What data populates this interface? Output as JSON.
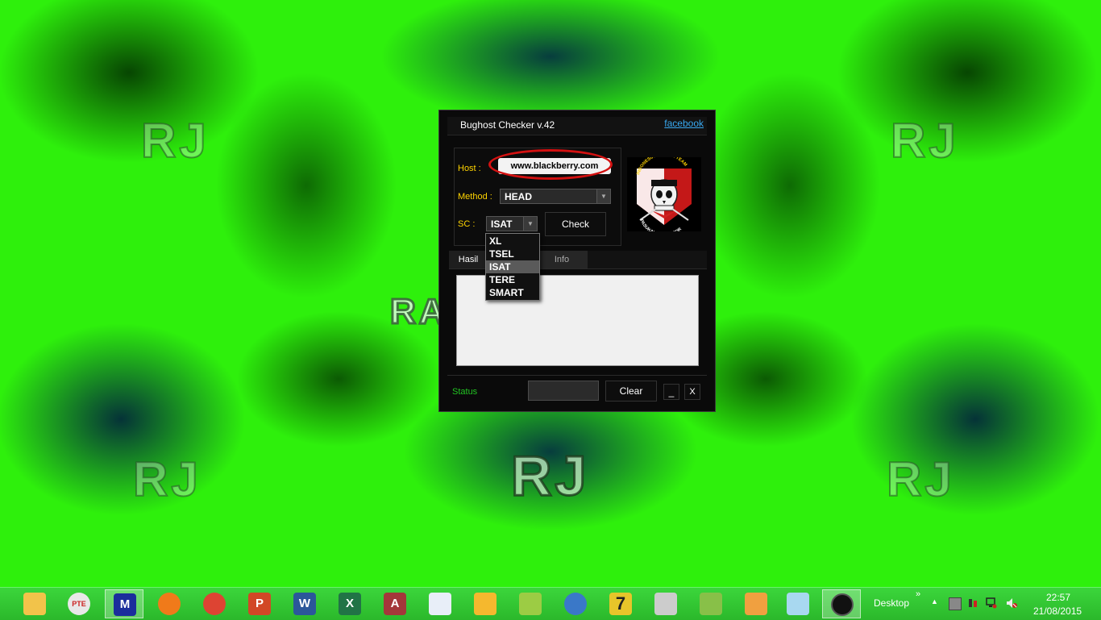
{
  "wallpaper": {
    "watermarks": [
      "RJ",
      "RJ",
      "RJ",
      "RJ",
      "RJ",
      "RA"
    ]
  },
  "app": {
    "title": "Bughost Checker v.42",
    "facebook_link": "facebook",
    "host_label": "Host :",
    "host_value": "www.blackberry.com",
    "method_label": "Method :",
    "method_value": "HEAD",
    "sc_label": "SC :",
    "sc_value": "ISAT",
    "sc_options": [
      "XL",
      "TSEL",
      "ISAT",
      "TERE",
      "SMART"
    ],
    "check_button": "Check",
    "tabs": [
      "Hasil",
      "Info"
    ],
    "status_label": "Status",
    "progress": 0,
    "clear_button": "Clear",
    "minimize_button": "_",
    "close_button": "X",
    "logo_text_top": "INDONESIAN CYBER TEAM",
    "logo_text_bottom": "PASUKAN ANTI TEROR"
  },
  "taskbar": {
    "apps": [
      {
        "name": "file-explorer",
        "text": "",
        "color": "#f2c34a"
      },
      {
        "name": "pte-patch",
        "text": "PTE",
        "color": "#e8e8e8"
      },
      {
        "name": "m-app",
        "text": "M",
        "color": "#1b2e9c"
      },
      {
        "name": "firefox",
        "text": "",
        "color": "#f07a1a"
      },
      {
        "name": "chrome",
        "text": "",
        "color": "#dd4433"
      },
      {
        "name": "powerpoint",
        "text": "P",
        "color": "#d24726"
      },
      {
        "name": "word",
        "text": "W",
        "color": "#2b579a"
      },
      {
        "name": "excel",
        "text": "X",
        "color": "#217346"
      },
      {
        "name": "access",
        "text": "A",
        "color": "#a4373a"
      },
      {
        "name": "visio",
        "text": "",
        "color": "#e8eef8"
      },
      {
        "name": "paint-tool",
        "text": "",
        "color": "#f5b82e"
      },
      {
        "name": "pencil-tool",
        "text": "",
        "color": "#9ccc44"
      },
      {
        "name": "webcam",
        "text": "",
        "color": "#3a78c8"
      },
      {
        "name": "seven-zip",
        "text": "7",
        "color": "#e8c52a"
      },
      {
        "name": "camera-tool",
        "text": "",
        "color": "#cccccc"
      },
      {
        "name": "green-tool",
        "text": "",
        "color": "#88c048"
      },
      {
        "name": "paint",
        "text": "",
        "color": "#f0a040"
      },
      {
        "name": "notepad",
        "text": "",
        "color": "#a8d8f0"
      },
      {
        "name": "bughost-app",
        "text": "",
        "color": "#111111"
      }
    ],
    "desktop_label": "Desktop",
    "chevron": "»",
    "time": "22:57",
    "date": "21/08/2015"
  },
  "colors": {
    "wallpaper_green": "#2ef00c",
    "label_yellow": "#ffd400",
    "status_green": "#22c522",
    "link_blue": "#38a8f0",
    "highlight_red": "#d31111"
  }
}
